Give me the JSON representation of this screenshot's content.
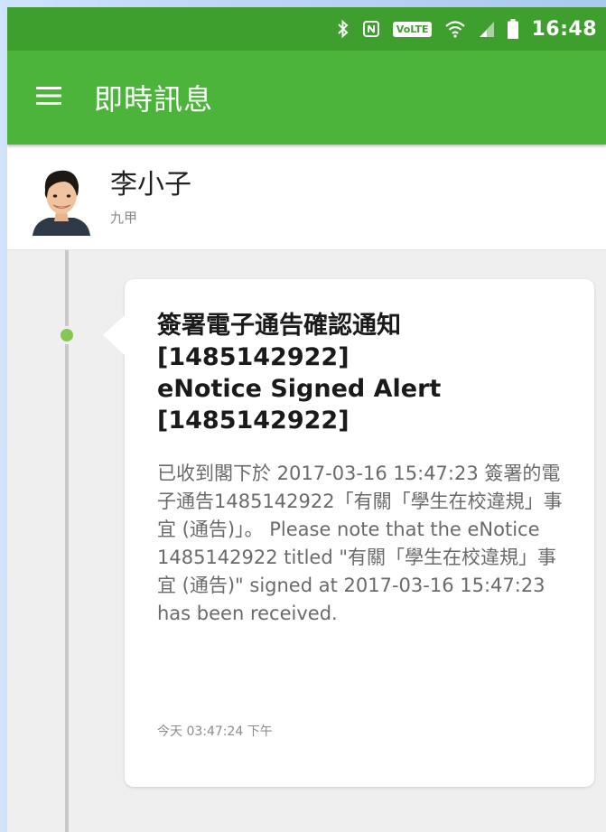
{
  "colors": {
    "statusbar": "#3e9e2e",
    "appbar": "#4cb43a",
    "timeline_dot": "#86c753",
    "background": "#efefef"
  },
  "status_bar": {
    "icons": [
      "bluetooth-icon",
      "nfc-icon",
      "volte-icon",
      "wifi-icon",
      "signal-icon",
      "battery-icon"
    ],
    "volte_label": "VoLTE",
    "time": "16:48"
  },
  "app_bar": {
    "menu_icon": "hamburger-menu-icon",
    "title": "即時訊息"
  },
  "contact": {
    "name": "李小子",
    "class_name": "九甲"
  },
  "message": {
    "title_lines": [
      "簽署電子通告確認通知",
      "[1485142922]",
      "eNotice Signed Alert",
      "[1485142922]"
    ],
    "body": "已收到閣下於 2017-03-16 15:47:23 簽署的電子通告1485142922「有關「學生在校違規」事宜 (通告)」。 Please note that the eNotice 1485142922 titled \"有關「學生在校違規」事宜 (通告)\" signed at 2017-03-16 15:47:23 has been received.",
    "timestamp": "今天 03:47:24 下午"
  }
}
